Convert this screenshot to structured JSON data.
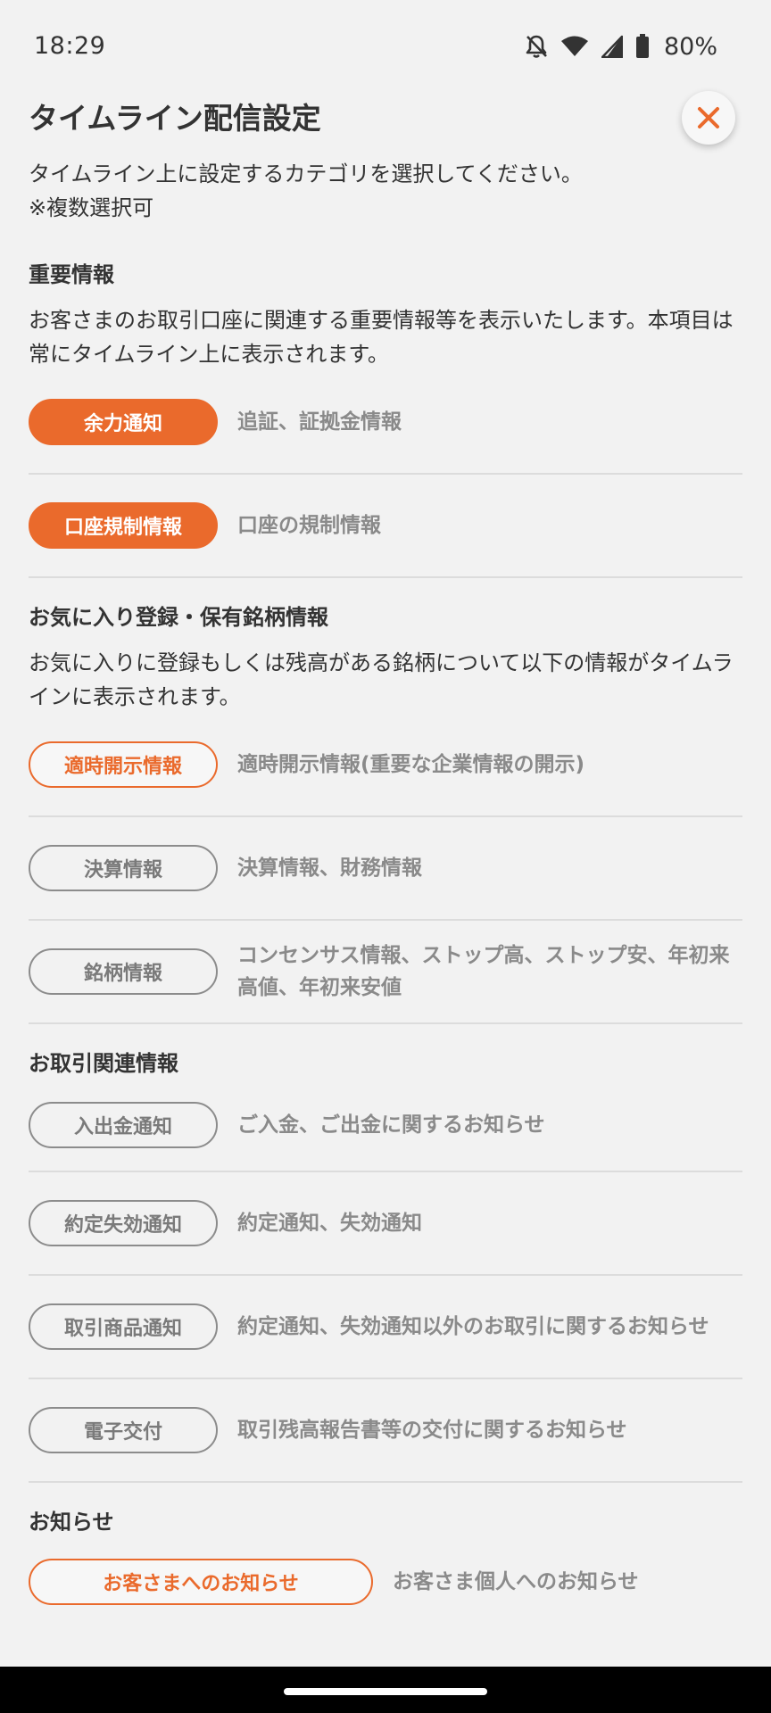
{
  "status_bar": {
    "time": "18:29",
    "battery": "80%",
    "icons": [
      "bell-off-icon",
      "wifi-icon",
      "signal-icon",
      "battery-icon"
    ]
  },
  "header": {
    "title": "タイムライン配信設定",
    "close_icon": "close-icon"
  },
  "intro": {
    "line1": "タイムライン上に設定するカテゴリを選択してください。",
    "line2": "※複数選択可"
  },
  "sections": {
    "important": {
      "title": "重要情報",
      "desc": "お客さまのお取引口座に関連する重要情報等を表示いたします。本項目は常にタイムライン上に表示されます。",
      "items": [
        {
          "label": "余力通知",
          "desc": "追証、証拠金情報",
          "state": "on"
        },
        {
          "label": "口座規制情報",
          "desc": "口座の規制情報",
          "state": "on"
        }
      ]
    },
    "favorites": {
      "title": "お気に入り登録・保有銘柄情報",
      "desc": "お気に入りに登録もしくは残高がある銘柄について以下の情報がタイムラインに表示されます。",
      "items": [
        {
          "label": "適時開示情報",
          "desc": "適時開示情報(重要な企業情報の開示)",
          "state": "selected"
        },
        {
          "label": "決算情報",
          "desc": "決算情報、財務情報",
          "state": "off"
        },
        {
          "label": "銘柄情報",
          "desc": "コンセンサス情報、ストップ高、ストップ安、年初来高値、年初来安値",
          "state": "off"
        }
      ]
    },
    "trading": {
      "title": "お取引関連情報",
      "items": [
        {
          "label": "入出金通知",
          "desc": "ご入金、ご出金に関するお知らせ",
          "state": "off"
        },
        {
          "label": "約定失効通知",
          "desc": "約定通知、失効通知",
          "state": "off"
        },
        {
          "label": "取引商品通知",
          "desc": "約定通知、失効通知以外のお取引に関するお知らせ",
          "state": "off"
        },
        {
          "label": "電子交付",
          "desc": "取引残高報告書等の交付に関するお知らせ",
          "state": "off"
        }
      ]
    },
    "notices": {
      "title": "お知らせ",
      "items": [
        {
          "label": "お客さまへのお知らせ",
          "desc": "お客さま個人へのお知らせ",
          "state": "selected"
        }
      ]
    }
  },
  "colors": {
    "accent": "#ea6a2c",
    "inactive_border": "#8c8c8c",
    "inactive_text": "#7a7a7a",
    "description_text": "#8a8a8a",
    "divider": "#dcdcdc",
    "background": "#f2f2f2"
  }
}
